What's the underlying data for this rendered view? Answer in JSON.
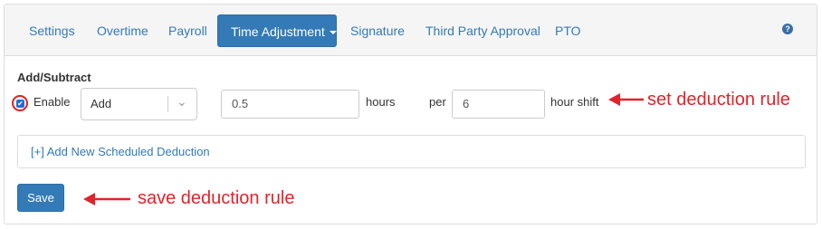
{
  "tabs": {
    "settings": "Settings",
    "overtime": "Overtime",
    "payroll": "Payroll",
    "time_adjustment": "Time Adjustment",
    "signature": "Signature",
    "third_party": "Third Party Approval",
    "pto": "PTO"
  },
  "help_icon": "question-circle-icon",
  "form": {
    "section_title": "Add/Subtract",
    "enable_label": "Enable",
    "enable_checked": true,
    "operation_value": "Add",
    "amount_value": "0.5",
    "amount_unit": "hours",
    "per_label": "per",
    "shift_value": "6",
    "shift_unit": "hour shift",
    "add_scheduled_link": "[+] Add New Scheduled Deduction",
    "save_label": "Save"
  },
  "annotations": {
    "set_rule": "set deduction rule",
    "save_rule": "save deduction rule",
    "color": "#e0242a"
  },
  "colors": {
    "accent": "#337ab7",
    "tabbar_bg": "#f5f5f5"
  }
}
